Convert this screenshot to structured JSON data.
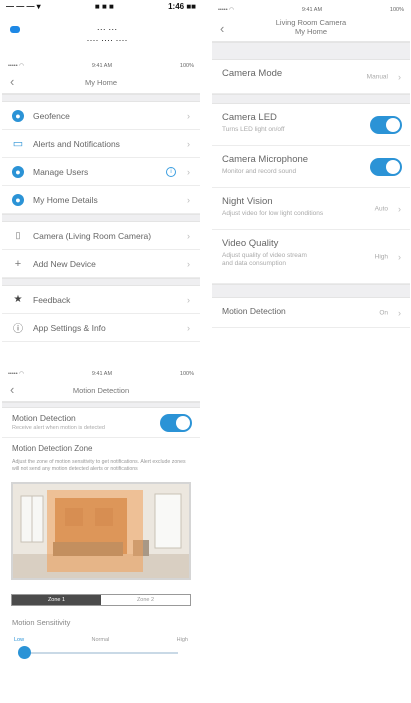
{
  "top_header": {
    "status_left": "— — — ▾",
    "status_mid": "■ ■ ■",
    "status_right": "1:46 ■■",
    "line1": "··· ···",
    "line2": "···· ···· ····"
  },
  "statusbar": {
    "carrier": "••••• ◠",
    "time": "9:41 AM",
    "battery": "100%"
  },
  "my_home": {
    "title": "My Home",
    "items": [
      {
        "label": "Geofence",
        "icon": "geofence-icon"
      },
      {
        "label": "Alerts and Notifications",
        "icon": "alerts-icon"
      },
      {
        "label": "Manage Users",
        "icon": "users-icon",
        "info": "i"
      },
      {
        "label": "My Home Details",
        "icon": "home-details-icon"
      },
      {
        "label": "Camera (Living Room Camera)",
        "icon": "camera-icon"
      },
      {
        "label": "Add New Device",
        "icon": "plus-icon"
      },
      {
        "label": "Feedback",
        "icon": "star-icon"
      },
      {
        "label": "App Settings & Info",
        "icon": "info-icon"
      }
    ]
  },
  "camera": {
    "title_line1": "Living Room Camera",
    "title_line2": "My Home",
    "mode_label": "Camera Mode",
    "mode_value": "Manual",
    "led_label": "Camera LED",
    "led_sub": "Turns LED light on/off",
    "mic_label": "Camera Microphone",
    "mic_sub": "Monitor and record sound",
    "night_label": "Night Vision",
    "night_sub": "Adjust video for low light conditions",
    "night_value": "Auto",
    "quality_label": "Video Quality",
    "quality_sub": "Adjust quality of video stream and data consumption",
    "quality_value": "High",
    "motion_label": "Motion Detection",
    "motion_value": "On"
  },
  "motion": {
    "title": "Motion Detection",
    "toggle_label": "Motion Detection",
    "toggle_sub": "Receive alert when motion is detected",
    "zone_label": "Motion Detection Zone",
    "zone_desc": "Adjust the zone of motion sensitivity to get notifications. Alert exclude zones will not send any motion detected alerts or notifications",
    "zone1": "Zone 1",
    "zone2": "Zone 2",
    "sensitivity_label": "Motion Sensitivity",
    "low": "Low",
    "normal": "Normal",
    "high": "High",
    "sensitivity_level": 0
  },
  "colors": {
    "accent": "#2b93d6",
    "zone_overlay": "#f0a05a"
  }
}
